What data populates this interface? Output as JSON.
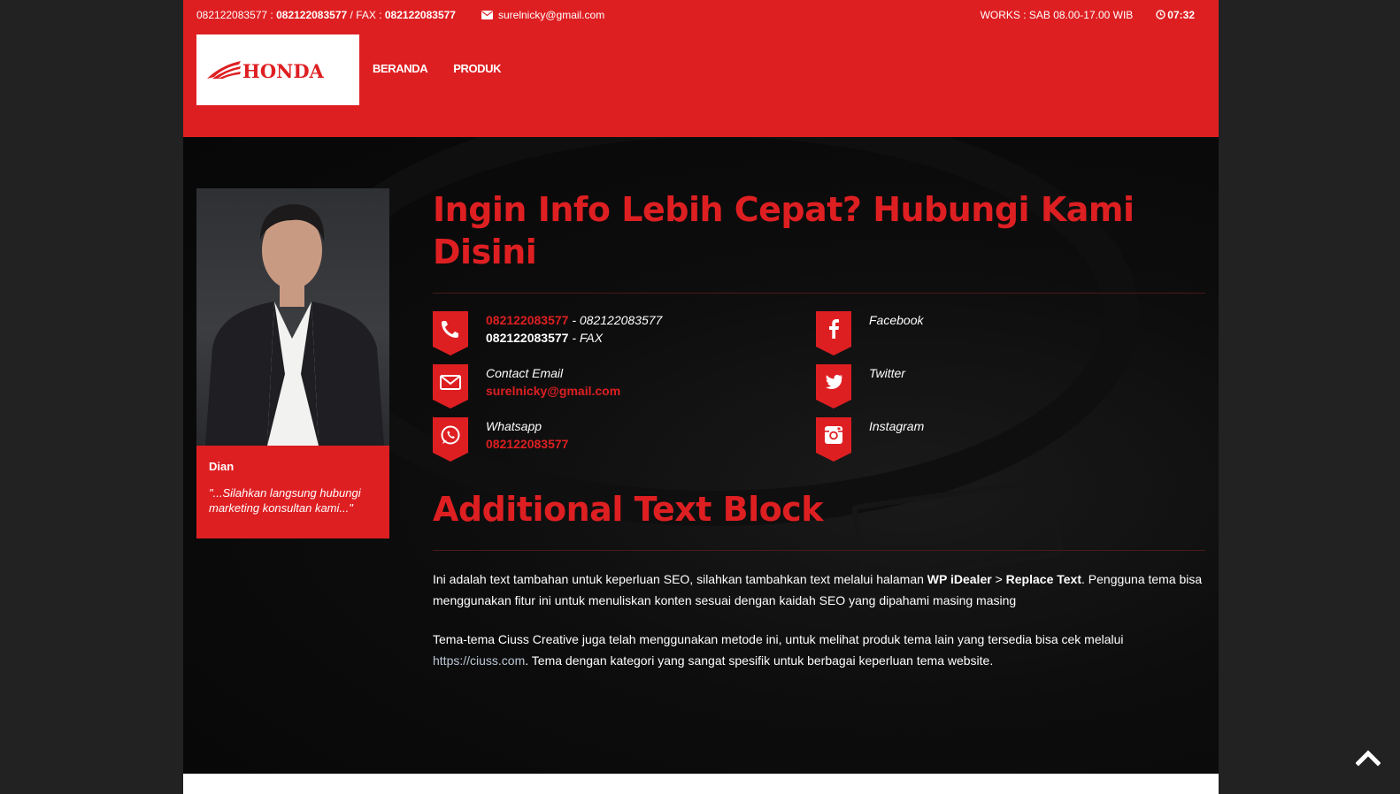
{
  "topbar": {
    "phone_prefix": "082122083577 : ",
    "phone_bold": "082122083577",
    "fax_label": " / FAX : ",
    "fax_bold": "082122083577",
    "email": "surelnicky@gmail.com",
    "works": "WORKS : SAB 08.00-17.00 WIB",
    "time": "07:32"
  },
  "logo": {
    "text": "HONDA"
  },
  "nav": {
    "items": [
      "BERANDA",
      "PRODUK"
    ]
  },
  "profile": {
    "name": "Dian",
    "quote": "\"...Silahkan langsung hubungi marketing konsultan kami...\""
  },
  "main": {
    "heading": "Ingin Info Lebih Cepat? Hubungi Kami Disini",
    "contacts": {
      "phone": {
        "number_red": "082122083577",
        "sep": " - ",
        "number_alt": "082122083577",
        "fax_number": "082122083577",
        "fax_label": " - FAX"
      },
      "email": {
        "label": "Contact Email",
        "value": "surelnicky@gmail.com"
      },
      "whatsapp": {
        "label": "Whatsapp",
        "value": "082122083577"
      },
      "facebook": {
        "label": "Facebook"
      },
      "twitter": {
        "label": "Twitter"
      },
      "instagram": {
        "label": "Instagram"
      }
    },
    "additional": {
      "heading": "Additional Text Block",
      "p1_a": "Ini adalah text tambahan untuk keperluan SEO, silahkan tambahkan text melalui halaman ",
      "p1_b1": "WP iDealer",
      "p1_gt": " > ",
      "p1_b2": "Replace Text",
      "p1_c": ". Pengguna tema bisa menggunakan fitur ini untuk menuliskan konten sesuai dengan kaidah SEO yang dipahami masing masing",
      "p2_a": "Tema-tema Ciuss Creative juga telah menggunakan metode ini, untuk melihat produk tema lain yang tersedia bisa cek melalui ",
      "p2_link": "https://ciuss.com",
      "p2_b": ". Tema dengan kategori yang sangat spesifik untuk berbagai keperluan tema website."
    }
  },
  "colors": {
    "brand_red": "#de1f22",
    "dark_bg": "#0a0a0a",
    "outer_bg": "#222222"
  },
  "icons": [
    "envelope-icon",
    "clock-icon",
    "phone-icon",
    "mail-icon",
    "whatsapp-icon",
    "facebook-icon",
    "twitter-icon",
    "instagram-icon",
    "chevron-up-icon"
  ]
}
